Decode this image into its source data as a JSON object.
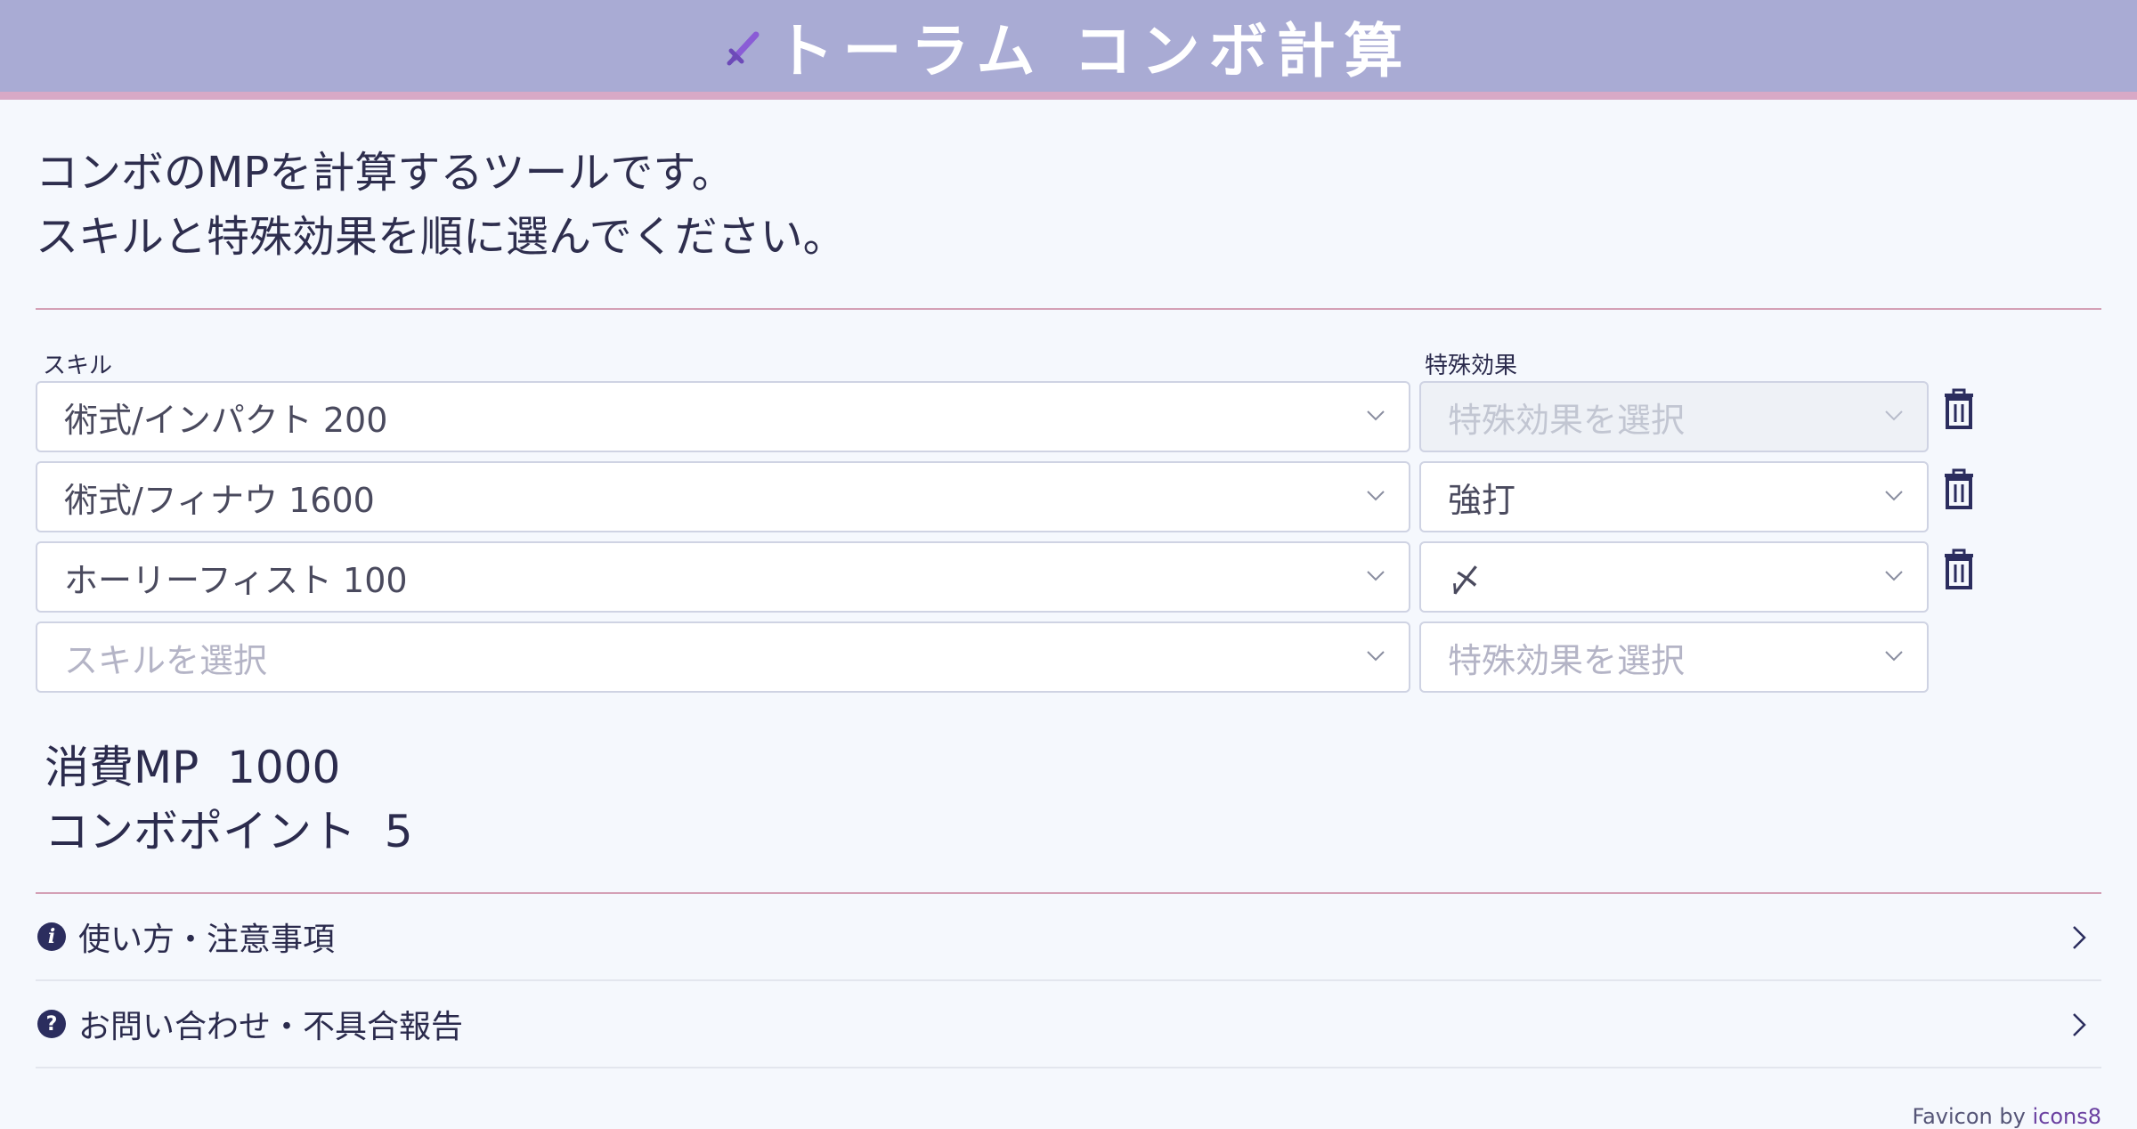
{
  "header": {
    "title": "トーラム コンボ計算",
    "icon": "sword-icon"
  },
  "intro": {
    "line1": "コンボのMPを計算するツールです。",
    "line2": "スキルと特殊効果を順に選んでください。"
  },
  "columns": {
    "skill_label": "スキル",
    "effect_label": "特殊効果"
  },
  "rows": [
    {
      "skill": "術式/インパクト 200",
      "effect": "特殊効果を選択",
      "effect_state": "disabled"
    },
    {
      "skill": "術式/フィナウ 1600",
      "effect": "強打",
      "effect_state": "selected"
    },
    {
      "skill": "ホーリーフィスト 100",
      "effect": "〆",
      "effect_state": "selected"
    },
    {
      "skill": "スキルを選択",
      "effect": "特殊効果を選択",
      "effect_state": "placeholder"
    }
  ],
  "results": {
    "mp_label": "消費MP",
    "mp_value": "1000",
    "cp_label": "コンボポイント",
    "cp_value": "5"
  },
  "accordion": [
    {
      "label": "使い方・注意事項",
      "icon": "info-icon"
    },
    {
      "label": "お問い合わせ・不具合報告",
      "icon": "question-icon"
    }
  ],
  "footer": {
    "text": "Favicon by",
    "link": "icons8"
  },
  "colors": {
    "header_bg": "#a9abd4",
    "header_border": "#d8a9c6",
    "page_bg": "#f5f8fd",
    "divider": "#d4a0b6"
  }
}
